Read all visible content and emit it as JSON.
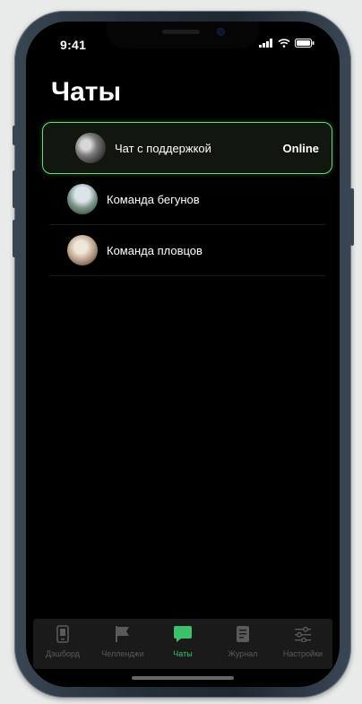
{
  "status_bar": {
    "time": "9:41"
  },
  "screen": {
    "title": "Чаты"
  },
  "chats": [
    {
      "name": "Чат с поддержкой",
      "status": "Online",
      "selected": true
    },
    {
      "name": "Команда бегунов"
    },
    {
      "name": "Команда пловцов"
    }
  ],
  "tabbar": {
    "items": [
      {
        "label": "Дэшборд",
        "icon": "phone-icon"
      },
      {
        "label": "Челленджи",
        "icon": "flag-icon"
      },
      {
        "label": "Чаты",
        "icon": "chat-icon",
        "active": true
      },
      {
        "label": "Журнал",
        "icon": "document-icon"
      },
      {
        "label": "Настройки",
        "icon": "sliders-icon"
      }
    ]
  },
  "colors": {
    "accent": "#3cc16a",
    "selected_border": "#6fd37a",
    "background": "#000000"
  }
}
